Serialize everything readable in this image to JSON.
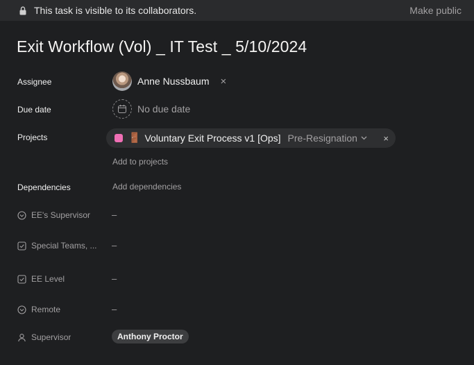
{
  "banner": {
    "message": "This task is visible to its collaborators.",
    "make_public": "Make public"
  },
  "task": {
    "title": "Exit Workflow (Vol) _ IT Test _ 5/10/2024"
  },
  "fields": {
    "assignee_label": "Assignee",
    "assignee_name": "Anne Nussbaum",
    "assignee_remove": "×",
    "due_label": "Due date",
    "due_value": "No due date",
    "projects_label": "Projects",
    "project": {
      "color": "#f06fb5",
      "emoji": "🚪",
      "name": "Voluntary Exit Process v1 [Ops]",
      "section": "Pre-Resignation",
      "remove": "×"
    },
    "add_to_projects": "Add to projects",
    "dependencies_label": "Dependencies",
    "add_dependencies": "Add dependencies"
  },
  "custom_fields": [
    {
      "label": "EE's Supervisor",
      "icon": "chevron-circle-icon",
      "value": "–"
    },
    {
      "label": "Special Teams, ...",
      "icon": "checkbox-icon",
      "value": "–"
    },
    {
      "label": "EE Level",
      "icon": "checkbox-icon",
      "value": "–"
    },
    {
      "label": "Remote",
      "icon": "chevron-circle-icon",
      "value": "–"
    },
    {
      "label": "Supervisor",
      "icon": "person-icon",
      "value": "Anthony Proctor"
    }
  ]
}
